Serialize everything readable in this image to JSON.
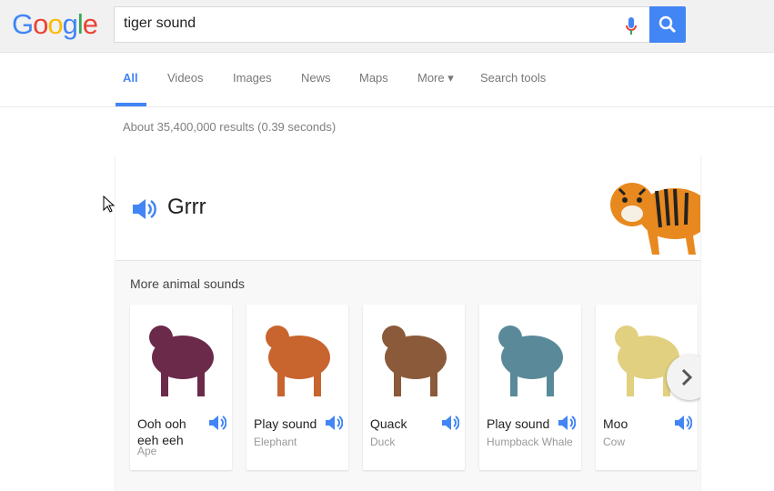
{
  "header": {
    "logo": "Google",
    "query": "tiger sound",
    "mic_icon": "mic-icon",
    "search_icon": "search-icon"
  },
  "tabs": [
    {
      "label": "All",
      "active": true
    },
    {
      "label": "Videos"
    },
    {
      "label": "Images"
    },
    {
      "label": "News"
    },
    {
      "label": "Maps"
    },
    {
      "label": "More ▾"
    },
    {
      "label": "Search tools"
    }
  ],
  "stats": "About 35,400,000 results (0.39 seconds)",
  "answer": {
    "sound": "Grrr",
    "animal_image": "tiger"
  },
  "more_sounds": {
    "title": "More animal sounds",
    "items": [
      {
        "sound": "Ooh ooh eeh eeh",
        "name": "Ape",
        "color": "#6b2a4a"
      },
      {
        "sound": "Play sound",
        "name": "Elephant",
        "color": "#c8642e"
      },
      {
        "sound": "Quack",
        "name": "Duck",
        "color": "#8a5a3a"
      },
      {
        "sound": "Play sound",
        "name": "Humpback Whale",
        "color": "#5a8a9a"
      },
      {
        "sound": "Moo",
        "name": "Cow",
        "color": "#e0d080"
      }
    ]
  },
  "colors": {
    "accent": "#4285f4"
  }
}
